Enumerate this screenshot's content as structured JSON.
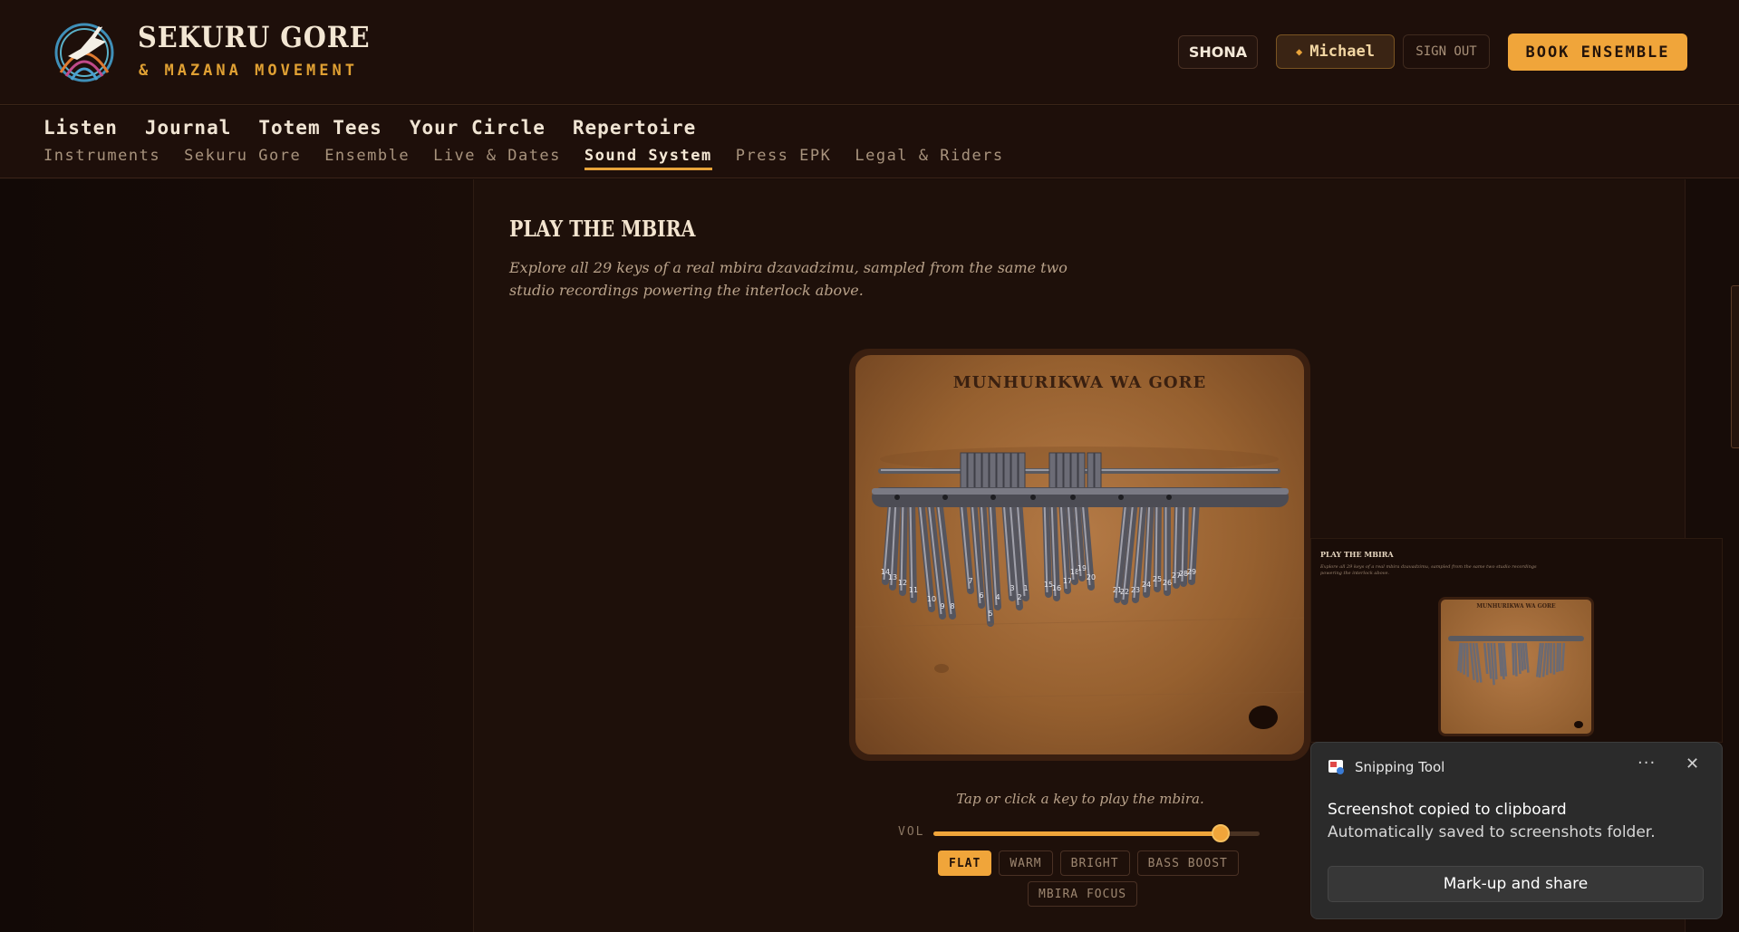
{
  "header": {
    "brand_title": "SEKURU GORE",
    "brand_subtitle": "& MAZANA MOVEMENT",
    "language_button": "SHONA",
    "user_name": "Michael",
    "sign_out": "SIGN OUT",
    "book_button": "BOOK ENSEMBLE"
  },
  "nav": {
    "primary": [
      "Listen",
      "Journal",
      "Totem Tees",
      "Your Circle",
      "Repertoire"
    ],
    "secondary": [
      "Instruments",
      "Sekuru Gore",
      "Ensemble",
      "Live & Dates",
      "Sound System",
      "Press EPK",
      "Legal & Riders"
    ],
    "active_secondary": "Sound System"
  },
  "section": {
    "title": "PLAY THE MBIRA",
    "description": "Explore all 29 keys of a real mbira dzavadzimu, sampled from the same two studio recordings powering the interlock above."
  },
  "mbira": {
    "board_title": "MUNHURIKWA WA GORE",
    "key_count": 29,
    "key_labels": [
      "14",
      "13",
      "12",
      "11",
      "10",
      "9",
      "8",
      "7",
      "6",
      "5",
      "4",
      "3",
      "2",
      "1",
      "15",
      "16",
      "17",
      "18",
      "19",
      "20",
      "21",
      "22",
      "23",
      "24",
      "25",
      "26",
      "27",
      "28",
      "29"
    ],
    "hint": "Tap or click a key to play the mbira."
  },
  "player": {
    "volume_label": "VOL",
    "volume_fraction": 0.88,
    "eq_presets": [
      "FLAT",
      "WARM",
      "BRIGHT",
      "BASS BOOST",
      "MBIRA FOCUS"
    ],
    "eq_active": "FLAT"
  },
  "snipping_tool": {
    "app_name": "Snipping Tool",
    "more_glyph": "···",
    "close_glyph": "✕",
    "message": "Screenshot copied to clipboard",
    "submessage": "Automatically saved to screenshots folder.",
    "action_button": "Mark-up and share",
    "preview_title": "PLAY THE MBIRA",
    "preview_desc": "Explore all 29 keys of a real mbira dzavadzimu, sampled from the same two studio recordings powering the interlock above.",
    "preview_board_title": "MUNHURIKWA WA GORE"
  },
  "colors": {
    "accent": "#f0a53a",
    "background": "#170c08",
    "panel": "#1e100a",
    "wood": "#a56c3a"
  },
  "icons": {
    "logo": "crane-bird-logo",
    "user_badge": "diamond-icon",
    "toast_app": "snipping-tool-icon"
  }
}
